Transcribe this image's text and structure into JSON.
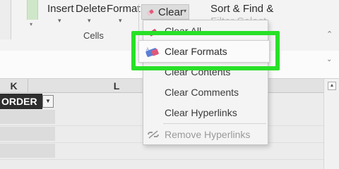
{
  "ribbon": {
    "buttons": {
      "insert": "Insert",
      "delete": "Delete",
      "format": "Format",
      "clear": "Clear",
      "sort_find_line1": "Sort & Find &",
      "sort_find_line2": "Filter Select"
    },
    "group_label": "Cells",
    "partial_top_text": "Clear All"
  },
  "menu": {
    "items": [
      {
        "label": "Clear All",
        "icon": "eraser-icon",
        "enabled": true
      },
      {
        "label": "Clear Formats",
        "icon": "clear-formats-icon",
        "enabled": true,
        "highlighted": true
      },
      {
        "label": "Clear Contents",
        "icon": "",
        "enabled": true
      },
      {
        "label": "Clear Comments",
        "icon": "",
        "enabled": true
      },
      {
        "label": "Clear Hyperlinks",
        "icon": "",
        "enabled": true
      },
      {
        "label": "Remove Hyperlinks",
        "icon": "unlink-icon",
        "enabled": false
      }
    ]
  },
  "sheet": {
    "columns": [
      "K",
      "L"
    ],
    "header_cell": "ORDER"
  },
  "colors": {
    "highlight": "#28e028",
    "header_cell_bg": "#2e2e2e",
    "ribbon_bg": "#f3f3f3"
  }
}
